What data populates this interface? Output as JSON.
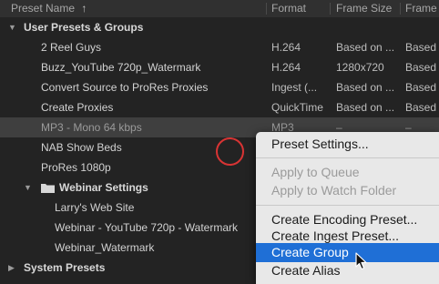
{
  "header": {
    "columns": [
      "Preset Name",
      "Format",
      "Frame Size",
      "Frame"
    ],
    "sort_icon": "↑"
  },
  "rows": [
    {
      "name": "User Presets & Groups",
      "format": "",
      "size": "",
      "frame": ""
    },
    {
      "name": "2 Reel Guys",
      "format": "H.264",
      "size": "Based on ...",
      "frame": "Based o"
    },
    {
      "name": "Buzz_YouTube 720p_Watermark",
      "format": "H.264",
      "size": "1280x720",
      "frame": "Based o"
    },
    {
      "name": "Convert Source to ProRes Proxies",
      "format": "Ingest (...",
      "size": "Based on ...",
      "frame": "Based o"
    },
    {
      "name": "Create Proxies",
      "format": "QuickTime",
      "size": "Based on ...",
      "frame": "Based o"
    },
    {
      "name": "MP3 - Mono 64 kbps",
      "format": "MP3",
      "size": "–",
      "frame": "–"
    },
    {
      "name": "NAB Show Beds",
      "format": "",
      "size": "",
      "frame": ""
    },
    {
      "name": "ProRes 1080p",
      "format": "",
      "size": "",
      "frame": ""
    },
    {
      "name": "Webinar Settings",
      "format": "",
      "size": "",
      "frame": ""
    },
    {
      "name": "Larry's Web Site",
      "format": "",
      "size": "",
      "frame": ""
    },
    {
      "name": "Webinar - YouTube 720p - Watermark",
      "format": "",
      "size": "",
      "frame": ""
    },
    {
      "name": "Webinar_Watermark",
      "format": "",
      "size": "",
      "frame": ""
    },
    {
      "name": "System Presets",
      "format": "",
      "size": "",
      "frame": ""
    }
  ],
  "context_menu": {
    "items": [
      {
        "label": "Preset Settings...",
        "enabled": true
      },
      {
        "label": "Apply to Queue",
        "enabled": false
      },
      {
        "label": "Apply to Watch Folder",
        "enabled": false
      },
      {
        "label": "Create Encoding Preset...",
        "enabled": true
      },
      {
        "label": "Create Ingest Preset...",
        "enabled": true
      },
      {
        "label": "Create Group",
        "enabled": true,
        "highlighted": true
      },
      {
        "label": "Create Alias",
        "enabled": true
      }
    ]
  },
  "colors": {
    "background": "#232323",
    "selected_row": "#3f3f3f",
    "menu_bg": "#e8e8e8",
    "menu_highlight": "#1f6fd6",
    "click_ring": "#d83434"
  }
}
